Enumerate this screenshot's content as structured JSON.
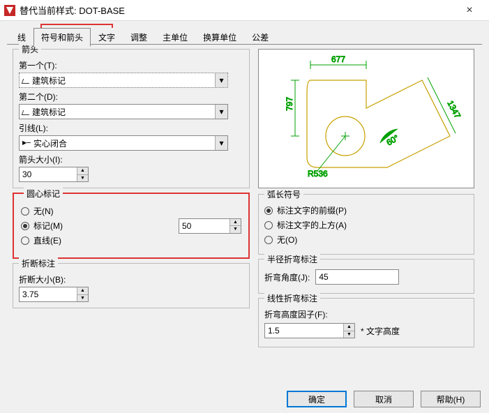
{
  "title": "替代当前样式: DOT-BASE",
  "tabs": {
    "t0": "线",
    "t1": "符号和箭头",
    "t2": "文字",
    "t3": "调整",
    "t4": "主单位",
    "t5": "换算单位",
    "t6": "公差"
  },
  "arrow": {
    "legend": "箭头",
    "first_lbl": "第一个(T):",
    "first_val": "建筑标记",
    "second_lbl": "第二个(D):",
    "second_val": "建筑标记",
    "leader_lbl": "引线(L):",
    "leader_val": "实心闭合",
    "size_lbl": "箭头大小(I):",
    "size_val": "30"
  },
  "center": {
    "legend": "圆心标记",
    "none": "无(N)",
    "mark": "标记(M)",
    "line": "直线(E)",
    "size_val": "50"
  },
  "break": {
    "legend": "折断标注",
    "size_lbl": "折断大小(B):",
    "size_val": "3.75"
  },
  "preview": {
    "d1": "677",
    "d2": "797",
    "d3": "1347",
    "d4": "R536",
    "d5": "60°"
  },
  "arc": {
    "legend": "弧长符号",
    "before": "标注文字的前缀(P)",
    "above": "标注文字的上方(A)",
    "none": "无(O)"
  },
  "jog": {
    "legend": "半径折弯标注",
    "angle_lbl": "折弯角度(J):",
    "angle_val": "45"
  },
  "linjog": {
    "legend": "线性折弯标注",
    "factor_lbl": "折弯高度因子(F):",
    "factor_val": "1.5",
    "suffix": "* 文字高度"
  },
  "btn": {
    "ok": "确定",
    "cancel": "取消",
    "help": "帮助(H)"
  }
}
